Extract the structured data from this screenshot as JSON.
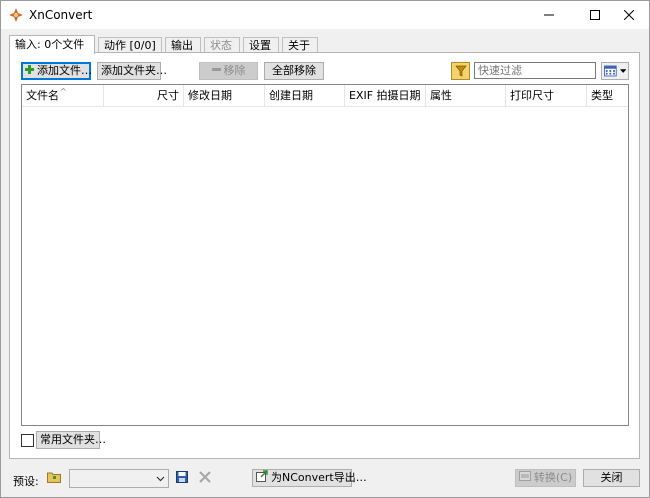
{
  "window": {
    "title": "XnConvert",
    "minimize_icon": "minimize-icon",
    "maximize_icon": "maximize-icon",
    "close_icon": "close-icon"
  },
  "tabs": [
    {
      "label": "输入: 0个文件",
      "active": true,
      "disabled": false
    },
    {
      "label": "动作 [0/0]",
      "active": false,
      "disabled": false
    },
    {
      "label": "输出",
      "active": false,
      "disabled": false
    },
    {
      "label": "状态",
      "active": false,
      "disabled": true
    },
    {
      "label": "设置",
      "active": false,
      "disabled": false
    },
    {
      "label": "关于",
      "active": false,
      "disabled": false
    }
  ],
  "toolbar": {
    "add_files": "添加文件…",
    "add_folder": "添加文件夹…",
    "remove": "移除",
    "remove_all": "全部移除",
    "filter_placeholder": "快速过滤"
  },
  "columns": [
    "文件名",
    "尺寸",
    "修改日期",
    "创建日期",
    "EXIF 拍摄日期",
    "属性",
    "打印尺寸",
    "类型"
  ],
  "bottom": {
    "favorites_button": "常用文件夹…",
    "preset_label": "预设:",
    "export_button": "为NConvert导出…",
    "convert_button": "转换(C)",
    "close_button": "关闭"
  },
  "colors": {
    "accent": "#0078d7",
    "panel": "#ffffff",
    "background": "#f0f0f0"
  }
}
